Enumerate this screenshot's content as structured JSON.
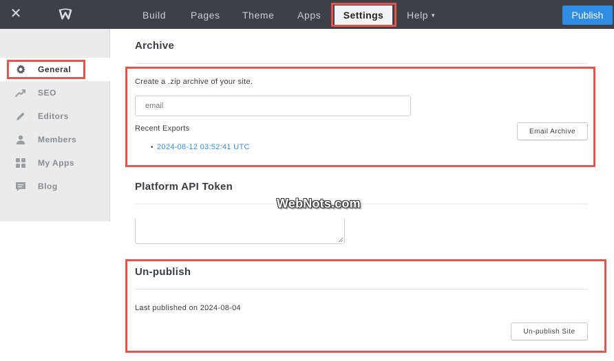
{
  "topbar": {
    "nav": [
      {
        "label": "Build"
      },
      {
        "label": "Pages"
      },
      {
        "label": "Theme"
      },
      {
        "label": "Apps"
      },
      {
        "label": "Settings",
        "active": true
      },
      {
        "label": "Help"
      }
    ],
    "publish_label": "Publish",
    "close_icon": "close-icon",
    "logo_icon": "weebly-logo-icon"
  },
  "sidebar": {
    "items": [
      {
        "label": "General",
        "icon": "gear-icon",
        "active": true
      },
      {
        "label": "SEO",
        "icon": "trend-icon"
      },
      {
        "label": "Editors",
        "icon": "pencil-icon"
      },
      {
        "label": "Members",
        "icon": "person-icon"
      },
      {
        "label": "My Apps",
        "icon": "grid-icon"
      },
      {
        "label": "Blog",
        "icon": "comment-icon"
      }
    ]
  },
  "archive": {
    "title": "Archive",
    "description": "Create a .zip archive of your site.",
    "email_placeholder": "email",
    "recent_exports_label": "Recent Exports",
    "exports": [
      "2024-08-12 03:52:41 UTC"
    ],
    "email_button": "Email Archive"
  },
  "api_token": {
    "title": "Platform API Token"
  },
  "unpublish": {
    "title": "Un-publish",
    "last_published": "Last published on 2024-08-04",
    "button": "Un-publish Site"
  },
  "watermark": "WebNots.com",
  "colors": {
    "topbar": "#3d4147",
    "accent": "#2f8de4",
    "highlight": "#e8534a",
    "sidebar": "#ebebeb"
  }
}
